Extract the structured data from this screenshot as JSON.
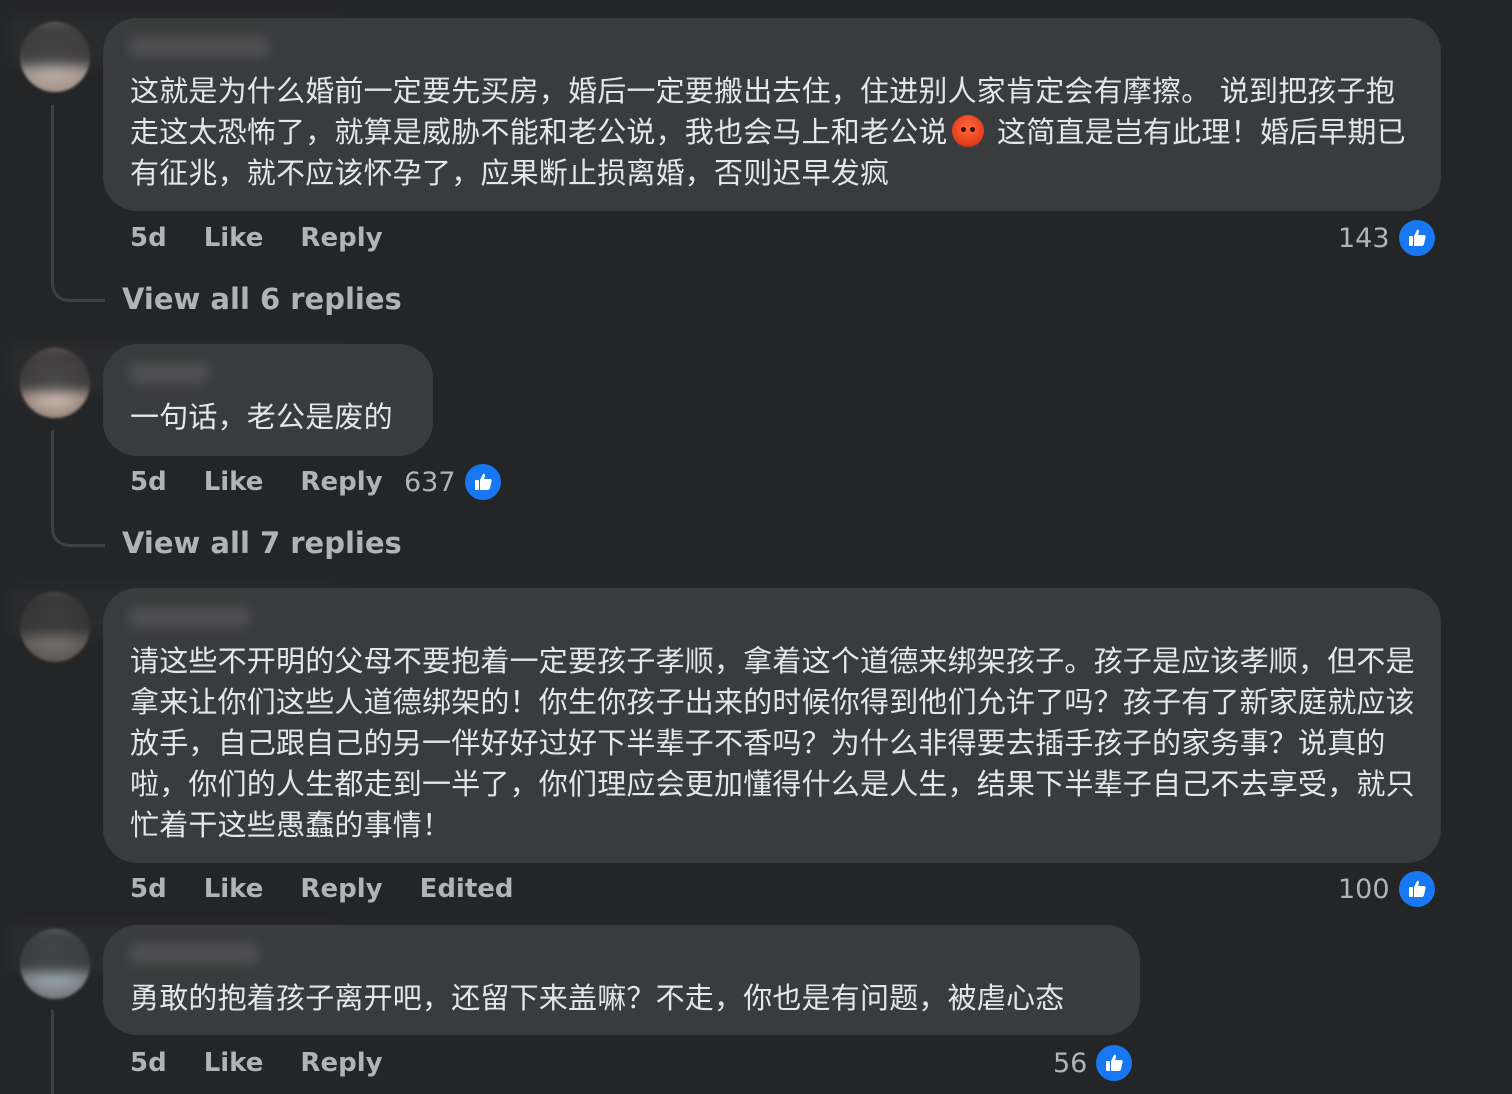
{
  "comments": [
    {
      "text_before_emoji": "这就是为什么婚前一定要先买房，婚后一定要搬出去住，住进别人家肯定会有摩擦。 说到把孩子抱走这太恐怖了，就算是威胁不能和老公说，我也会马上和老公说",
      "emoji": "angry-face",
      "text_after_emoji": " 这简直是岂有此理！婚后早期已有征兆，就不应该怀孕了，应果断止损离婚，否则迟早发疯",
      "time": "5d",
      "like": "Like",
      "reply": "Reply",
      "like_count": "143",
      "view_replies": "View all 6 replies"
    },
    {
      "text": "一句话，老公是废的",
      "time": "5d",
      "like": "Like",
      "reply": "Reply",
      "like_count": "637",
      "view_replies": "View all 7 replies"
    },
    {
      "text": "请这些不开明的父母不要抱着一定要孩子孝顺，拿着这个道德来绑架孩子。孩子是应该孝顺，但不是拿来让你们这些人道德绑架的！你生你孩子出来的时候你得到他们允许了吗？孩子有了新家庭就应该放手，自己跟自己的另一伴好好过好下半辈子不香吗？为什么非得要去插手孩子的家务事？说真的啦，你们的人生都走到一半了，你们理应会更加懂得什么是人生，结果下半辈子自己不去享受，就只忙着干这些愚蠢的事情！",
      "time": "5d",
      "like": "Like",
      "reply": "Reply",
      "edited": "Edited",
      "like_count": "100"
    },
    {
      "text": "勇敢的抱着孩子离开吧，还留下来盖嘛？不走，你也是有问题，被虐心态",
      "time": "5d",
      "like": "Like",
      "reply": "Reply",
      "like_count": "56"
    }
  ],
  "colors": {
    "background": "#242526",
    "bubble": "#3a3b3c",
    "like_blue": "#1877f2",
    "muted": "#b0b3b8"
  }
}
